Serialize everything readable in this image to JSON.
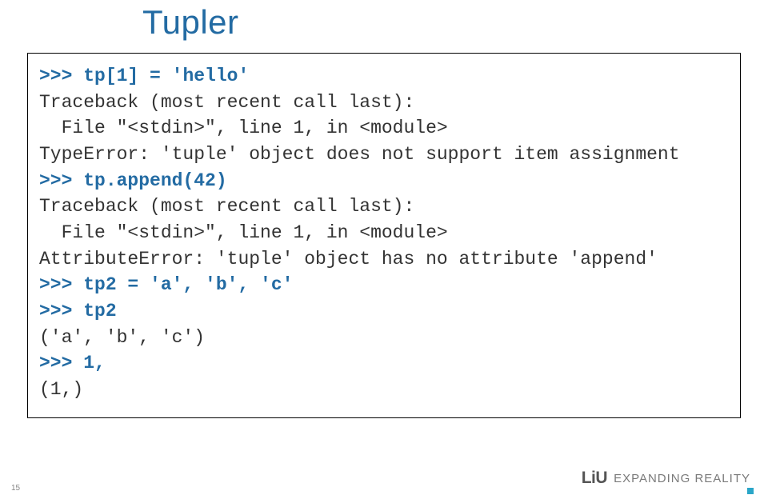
{
  "title": "Tupler",
  "code": {
    "l1_prompt": ">>> ",
    "l1_input": "tp[1] = 'hello'",
    "l2": "Traceback (most recent call last):",
    "l3": "  File \"<stdin>\", line 1, in <module>",
    "l4": "TypeError: 'tuple' object does not support item assignment",
    "l5_prompt": ">>> ",
    "l5_input": "tp.append(42)",
    "l6": "Traceback (most recent call last):",
    "l7": "  File \"<stdin>\", line 1, in <module>",
    "l8": "AttributeError: 'tuple' object has no attribute 'append'",
    "l9_prompt": ">>> ",
    "l9_input": "tp2 = 'a', 'b', 'c'",
    "l10_prompt": ">>> ",
    "l10_input": "tp2",
    "l11": "('a', 'b', 'c')",
    "l12_prompt": ">>> ",
    "l12_input": "1,",
    "l13": "(1,)"
  },
  "footer": {
    "logo": "LiU",
    "tagline": "EXPANDING REALITY"
  },
  "page": "15"
}
